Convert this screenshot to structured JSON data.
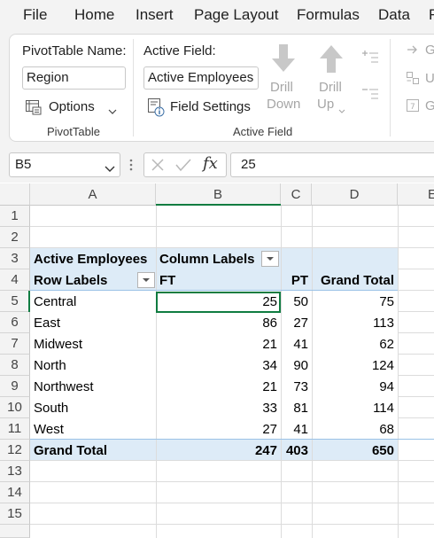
{
  "menu": {
    "file": "File",
    "home": "Home",
    "insert": "Insert",
    "page_layout": "Page Layout",
    "formulas": "Formulas",
    "data": "Data",
    "next_partial": "R"
  },
  "ribbon": {
    "pivottable": {
      "name_label": "PivotTable Name:",
      "name_value": "Region",
      "options_label": "Options",
      "group_label": "PivotTable"
    },
    "active_field": {
      "label": "Active Field:",
      "value": "Active Employees",
      "settings_label": "Field Settings",
      "drill_down_line1": "Drill",
      "drill_down_line2": "Down",
      "drill_up_line1": "Drill",
      "drill_up_line2": "Up",
      "group_label": "Active Field"
    },
    "right_partial": {
      "item1": "G",
      "item2": "U",
      "item3": "G"
    }
  },
  "formula_bar": {
    "name_box": "B5",
    "fx_label": "fx",
    "formula_value": "25"
  },
  "sheet": {
    "columns": [
      "A",
      "B",
      "C",
      "D",
      "E"
    ],
    "rows": [
      "1",
      "2",
      "3",
      "4",
      "5",
      "6",
      "7",
      "8",
      "9",
      "10",
      "11",
      "12",
      "13",
      "14",
      "15"
    ],
    "pivot": {
      "values_header": "Active Employees",
      "column_labels": "Column Labels",
      "row_labels": "Row Labels",
      "col_headers": [
        "FT",
        "PT",
        "Grand Total"
      ],
      "data": [
        {
          "label": "Central",
          "ft": "25",
          "pt": "50",
          "total": "75"
        },
        {
          "label": "East",
          "ft": "86",
          "pt": "27",
          "total": "113"
        },
        {
          "label": "Midwest",
          "ft": "21",
          "pt": "41",
          "total": "62"
        },
        {
          "label": "North",
          "ft": "34",
          "pt": "90",
          "total": "124"
        },
        {
          "label": "Northwest",
          "ft": "21",
          "pt": "73",
          "total": "94"
        },
        {
          "label": "South",
          "ft": "33",
          "pt": "81",
          "total": "114"
        },
        {
          "label": "West",
          "ft": "27",
          "pt": "41",
          "total": "68"
        }
      ],
      "grand_total": {
        "label": "Grand Total",
        "ft": "247",
        "pt": "403",
        "total": "650"
      }
    }
  },
  "colors": {
    "pivot_header_fill": "#ddebf7",
    "ribbon_background": "#f3f3f3",
    "grayed_text": "#a6a6a6"
  }
}
